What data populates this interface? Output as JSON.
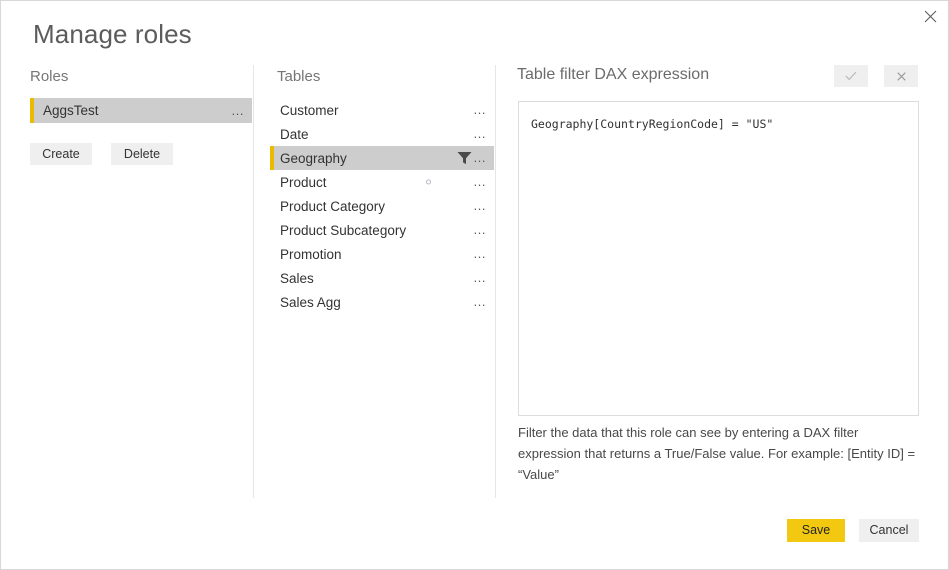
{
  "dialog": {
    "title": "Manage roles",
    "close_icon": "close-icon"
  },
  "roles_panel": {
    "header": "Roles",
    "items": [
      {
        "label": "AggsTest",
        "selected": true,
        "menu": "…"
      }
    ],
    "create_label": "Create",
    "delete_label": "Delete"
  },
  "tables_panel": {
    "header": "Tables",
    "items": [
      {
        "label": "Customer",
        "selected": false,
        "filtered": false,
        "dot": false,
        "menu": "…"
      },
      {
        "label": "Date",
        "selected": false,
        "filtered": false,
        "dot": false,
        "menu": "…"
      },
      {
        "label": "Geography",
        "selected": true,
        "filtered": true,
        "dot": false,
        "menu": "…"
      },
      {
        "label": "Product",
        "selected": false,
        "filtered": false,
        "dot": true,
        "menu": "…"
      },
      {
        "label": "Product Category",
        "selected": false,
        "filtered": false,
        "dot": false,
        "menu": "…"
      },
      {
        "label": "Product Subcategory",
        "selected": false,
        "filtered": false,
        "dot": false,
        "menu": "…"
      },
      {
        "label": "Promotion",
        "selected": false,
        "filtered": false,
        "dot": false,
        "menu": "…"
      },
      {
        "label": "Sales",
        "selected": false,
        "filtered": false,
        "dot": false,
        "menu": "…"
      },
      {
        "label": "Sales Agg",
        "selected": false,
        "filtered": false,
        "dot": false,
        "menu": "…"
      }
    ]
  },
  "dax_panel": {
    "header": "Table filter DAX expression",
    "accept_icon": "checkmark-icon",
    "reject_icon": "cross-icon",
    "expression": "Geography[CountryRegionCode] = \"US\"",
    "help_text": "Filter the data that this role can see by entering a DAX filter expression that returns a True/False value. For example: [Entity ID] = “Value”"
  },
  "footer": {
    "save_label": "Save",
    "cancel_label": "Cancel"
  },
  "colors": {
    "accent_yellow": "#e8bb00",
    "primary_button": "#f2c811",
    "selected_row": "#cdcdcd",
    "button_gray": "#efefef",
    "divider": "#e6e6e6"
  }
}
